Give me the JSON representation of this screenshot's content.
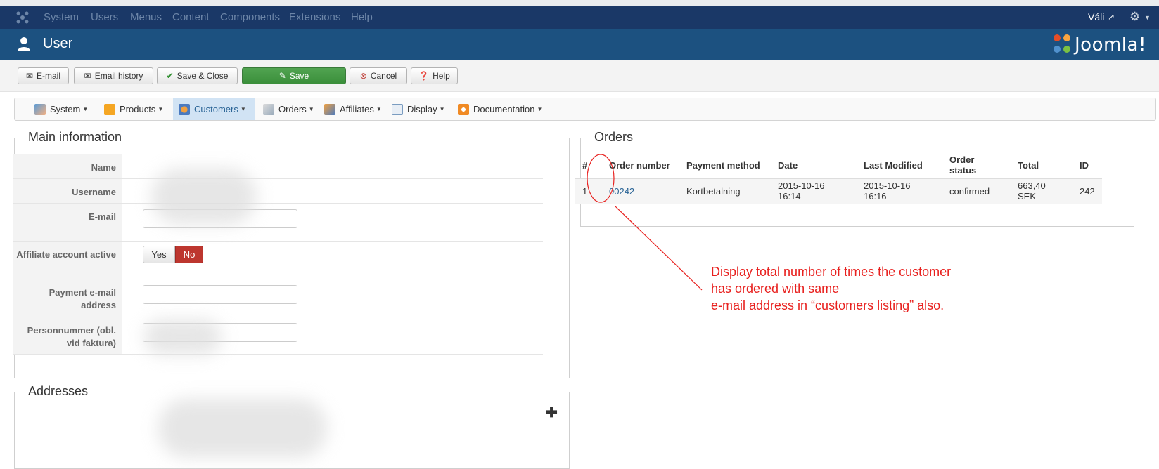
{
  "topmenu": {
    "items": [
      "System",
      "Users",
      "Menus",
      "Content",
      "Components",
      "Extensions",
      "Help"
    ],
    "user_label": "Váli",
    "colors": {
      "bar": "#1a3867",
      "item": "#6d86a8"
    }
  },
  "header": {
    "title": "User",
    "brand": "Joomla!",
    "color": "#1c5180"
  },
  "toolbar": {
    "email": "E-mail",
    "email_history": "Email history",
    "save_close": "Save & Close",
    "save": "Save",
    "cancel": "Cancel",
    "help": "Help"
  },
  "subnav": {
    "items": [
      "System",
      "Products",
      "Customers",
      "Orders",
      "Affiliates",
      "Display",
      "Documentation"
    ],
    "active": "Customers"
  },
  "main_info": {
    "legend": "Main information",
    "fields": {
      "name_label": "Name",
      "username_label": "Username",
      "email_label": "E-mail",
      "affiliate_label": "Affiliate account active",
      "payment_email_label": "Payment e-mail address",
      "personnummer_label": "Personnummer (obl. vid faktura)"
    },
    "affiliate_toggle": {
      "yes": "Yes",
      "no": "No",
      "selected": "No"
    }
  },
  "addresses": {
    "legend": "Addresses"
  },
  "orders": {
    "legend": "Orders",
    "columns": [
      "#",
      "Order number",
      "Payment method",
      "Date",
      "Last Modified",
      "Order status",
      "Total",
      "ID"
    ],
    "rows": [
      {
        "num": "1",
        "order_number": "00242",
        "payment_method": "Kortbetalning",
        "date": "2015-10-16 16:14",
        "last_modified": "2015-10-16 16:16",
        "status": "confirmed",
        "total": "663,40 SEK",
        "id": "242"
      }
    ]
  },
  "annotation": {
    "line1": "Display total number of times the customer",
    "line2": "has ordered with same",
    "line3": "e-mail address in “customers listing” also.",
    "color": "#e8201e"
  }
}
